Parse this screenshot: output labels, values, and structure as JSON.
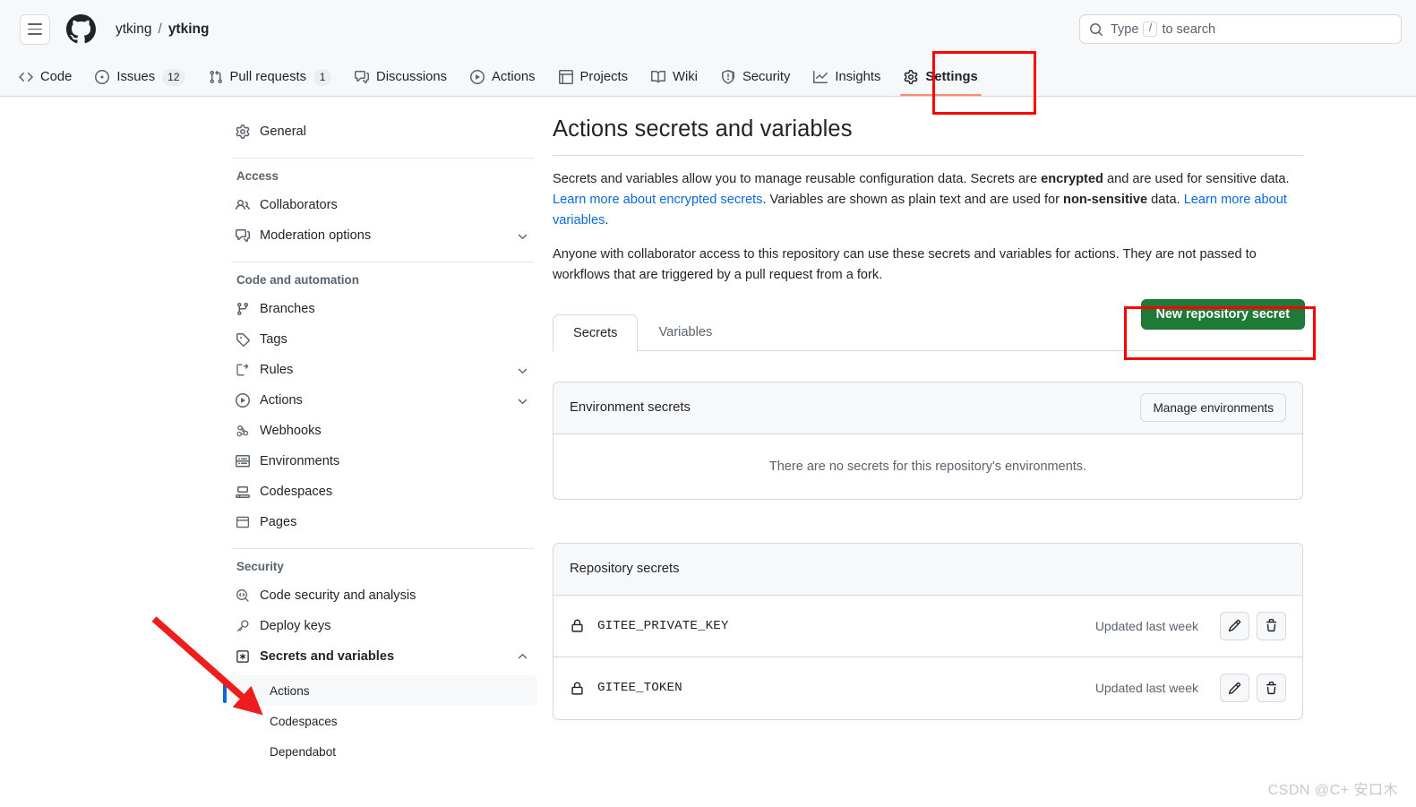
{
  "header": {
    "menu_icon": "hamburger-icon",
    "logo_icon": "github-logo-icon",
    "owner": "ytking",
    "separator": "/",
    "repo": "ytking",
    "search": {
      "icon": "search-icon",
      "placeholder_prefix": "Type",
      "key_hint": "/",
      "placeholder_suffix": "to search"
    }
  },
  "repo_nav": {
    "items": [
      {
        "label": "Code",
        "icon": "code-icon",
        "badge": null,
        "active": false
      },
      {
        "label": "Issues",
        "icon": "issue-opened-icon",
        "badge": "12",
        "active": false
      },
      {
        "label": "Pull requests",
        "icon": "git-pull-request-icon",
        "badge": "1",
        "active": false
      },
      {
        "label": "Discussions",
        "icon": "comment-discussion-icon",
        "badge": null,
        "active": false
      },
      {
        "label": "Actions",
        "icon": "play-icon",
        "badge": null,
        "active": false
      },
      {
        "label": "Projects",
        "icon": "table-icon",
        "badge": null,
        "active": false
      },
      {
        "label": "Wiki",
        "icon": "book-icon",
        "badge": null,
        "active": false
      },
      {
        "label": "Security",
        "icon": "shield-icon",
        "badge": null,
        "active": false
      },
      {
        "label": "Insights",
        "icon": "graph-icon",
        "badge": null,
        "active": false
      },
      {
        "label": "Settings",
        "icon": "gear-icon",
        "badge": null,
        "active": true
      }
    ],
    "active_underline_color": "#fd8c73"
  },
  "sidebar": {
    "general": {
      "label": "General",
      "icon": "gear-icon"
    },
    "groups": [
      {
        "heading": "Access",
        "items": [
          {
            "label": "Collaborators",
            "icon": "people-icon",
            "caret": false
          },
          {
            "label": "Moderation options",
            "icon": "comment-discussion-icon",
            "caret": "down"
          }
        ]
      },
      {
        "heading": "Code and automation",
        "items": [
          {
            "label": "Branches",
            "icon": "git-branch-icon",
            "caret": false
          },
          {
            "label": "Tags",
            "icon": "tag-icon",
            "caret": false
          },
          {
            "label": "Rules",
            "icon": "rule-icon",
            "caret": "down"
          },
          {
            "label": "Actions",
            "icon": "play-icon",
            "caret": "down"
          },
          {
            "label": "Webhooks",
            "icon": "webhook-icon",
            "caret": false
          },
          {
            "label": "Environments",
            "icon": "server-icon",
            "caret": false
          },
          {
            "label": "Codespaces",
            "icon": "codespaces-icon",
            "caret": false
          },
          {
            "label": "Pages",
            "icon": "browser-icon",
            "caret": false
          }
        ]
      },
      {
        "heading": "Security",
        "items": [
          {
            "label": "Code security and analysis",
            "icon": "codescan-icon",
            "caret": false
          },
          {
            "label": "Deploy keys",
            "icon": "key-icon",
            "caret": false
          },
          {
            "label": "Secrets and variables",
            "icon": "asterisk-key-icon",
            "caret": "up",
            "bold": true
          }
        ],
        "subitems": [
          {
            "label": "Actions",
            "selected": true
          },
          {
            "label": "Codespaces",
            "selected": false
          },
          {
            "label": "Dependabot",
            "selected": false
          }
        ]
      }
    ],
    "selected_accent": "#0969da"
  },
  "main": {
    "title": "Actions secrets and variables",
    "intro": {
      "p1_part1": "Secrets and variables allow you to manage reusable configuration data. Secrets are ",
      "p1_bold1": "encrypted",
      "p1_part2": " and are used for sensitive data. ",
      "p1_link1": "Learn more about encrypted secrets",
      "p1_part3": ". Variables are shown as plain text and are used for ",
      "p1_bold2": "non-sensitive",
      "p1_part4": " data. ",
      "p1_link2": "Learn more about variables",
      "p1_part5": ".",
      "p2": "Anyone with collaborator access to this repository can use these secrets and variables for actions. They are not passed to workflows that are triggered by a pull request from a fork."
    },
    "tabs": [
      {
        "label": "Secrets",
        "active": true
      },
      {
        "label": "Variables",
        "active": false
      }
    ],
    "new_secret_button": "New repository secret",
    "new_secret_color": "#1f7a37",
    "environment_secrets": {
      "title": "Environment secrets",
      "manage_button": "Manage environments",
      "empty_message": "There are no secrets for this repository's environments."
    },
    "repository_secrets": {
      "title": "Repository secrets",
      "rows": [
        {
          "lock_icon": "lock-icon",
          "name": "GITEE_PRIVATE_KEY",
          "updated": "Updated last week",
          "edit_icon": "pencil-icon",
          "delete_icon": "trash-icon"
        },
        {
          "lock_icon": "lock-icon",
          "name": "GITEE_TOKEN",
          "updated": "Updated last week",
          "edit_icon": "pencil-icon",
          "delete_icon": "trash-icon"
        }
      ]
    }
  },
  "annotations": {
    "color": "#ff0000",
    "settings_box_label": "settings-tab-highlight",
    "new_secret_box_label": "new-repository-secret-highlight",
    "arrow_label": "pointer-arrow-to-actions"
  },
  "watermark": "CSDN @C+  安口木"
}
